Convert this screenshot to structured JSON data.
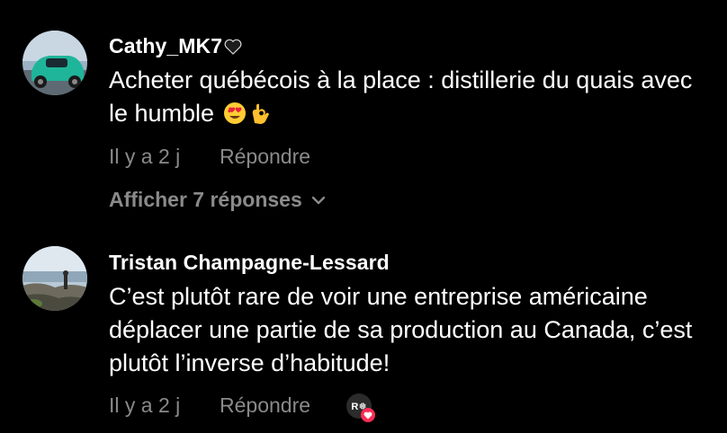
{
  "comments": [
    {
      "username": "Cathy_MK7",
      "username_emoji": "black-heart",
      "text": "Acheter québécois à la place : distillerie du quais avec le humble",
      "text_emojis": [
        "heart-eyes",
        "ok-hand"
      ],
      "timestamp": "Il y a 2 j",
      "reply_label": "Répondre",
      "view_replies_label": "Afficher 7 réponses"
    },
    {
      "username": "Tristan Champagne-Lessard",
      "text": "C’est plutôt rare de voir une entreprise américaine déplacer une partie de sa production au Canada, c’est plutôt l’inverse d’habitude!",
      "timestamp": "Il y a 2 j",
      "reply_label": "Répondre",
      "creator_badge": {
        "initials": "R❅",
        "icon": "heart-icon",
        "meaning": "liked by creator"
      }
    }
  ],
  "colors": {
    "background": "#000000",
    "primary_text": "#ffffff",
    "secondary_text": "#8a8a8a",
    "like_heart": "#fe2c55"
  }
}
